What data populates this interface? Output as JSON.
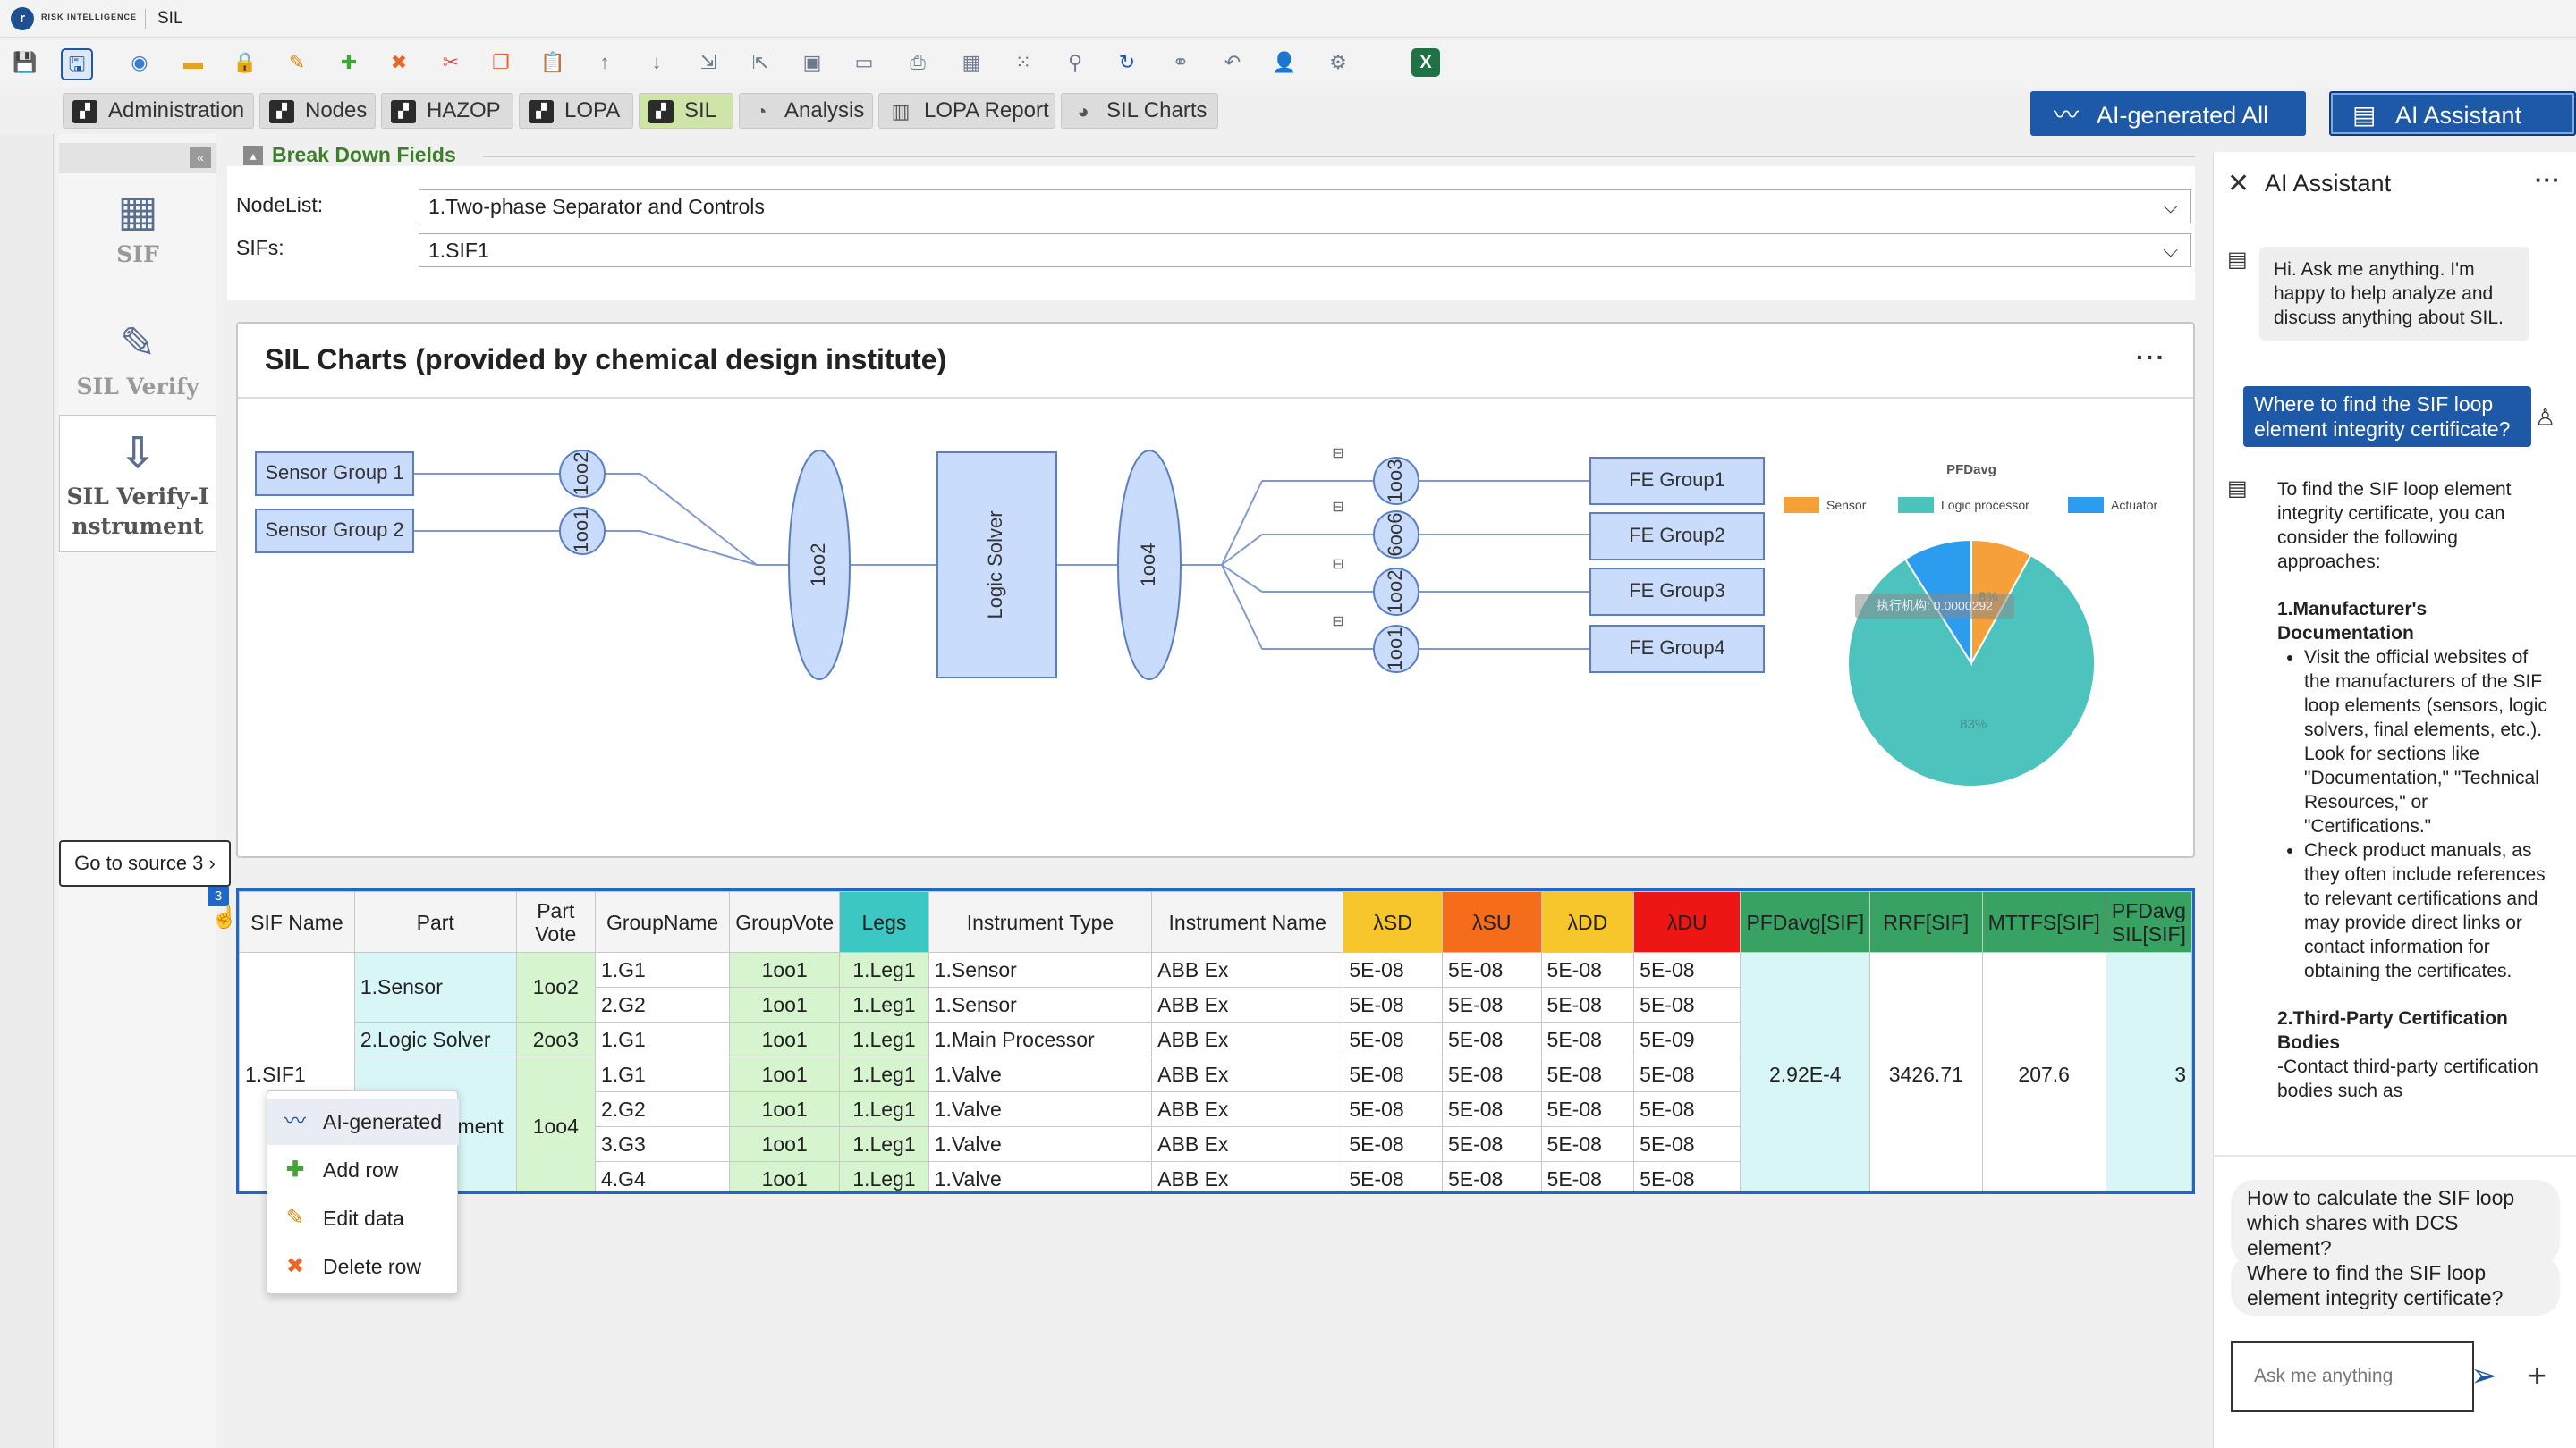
{
  "titlebar": {
    "logo_letter": "r",
    "logo_text": "RISK INTELLIGENCE",
    "title": "SIL"
  },
  "toolbar": {
    "icons": [
      "save-icon",
      "save-as-icon",
      "refresh-icon",
      "folder-icon",
      "lock-icon",
      "edit-icon",
      "add-icon",
      "delete-icon",
      "cut-icon",
      "copy-icon",
      "paste-icon",
      "arrow-up-icon",
      "arrow-down-icon",
      "import-icon",
      "export-icon",
      "layout-icon",
      "grid-icon",
      "print-icon",
      "calculate-icon",
      "color-icon",
      "filter-icon",
      "sync-icon",
      "link-icon",
      "undo-icon",
      "user-icon",
      "settings-icon",
      "excel-icon"
    ]
  },
  "left_gutter": {
    "expand_label": "»"
  },
  "tabs": [
    {
      "label": "Administration",
      "icon": "module-icon",
      "active": false
    },
    {
      "label": "Nodes",
      "icon": "module-icon",
      "active": false
    },
    {
      "label": "HAZOP",
      "icon": "module-icon",
      "active": false
    },
    {
      "label": "LOPA",
      "icon": "module-icon",
      "active": false
    },
    {
      "label": "SIL",
      "icon": "module-icon",
      "active": true
    },
    {
      "label": "Analysis",
      "icon": "analysis-icon",
      "active": false
    },
    {
      "label": "LOPA Report",
      "icon": "report-icon",
      "active": false
    },
    {
      "label": "SIL Charts",
      "icon": "pie-chart-icon",
      "active": false
    }
  ],
  "top_buttons": {
    "ai_generated_all": "AI-generated All",
    "ai_assistant": "AI Assistant"
  },
  "sidebar": {
    "collapse_label": "«",
    "items": [
      {
        "label": "SIF",
        "icon": "sif-grid-icon"
      },
      {
        "label": "SIL Verify",
        "icon": "verify-edit-icon"
      },
      {
        "label_line1": "SIL Verify-I",
        "label_line2": "nstrument",
        "icon": "instrument-verify-icon"
      }
    ]
  },
  "breakdown": {
    "title": "Break Down Fields",
    "toggle": "▴",
    "nodelist_label": "NodeList:",
    "nodelist_value": "1.Two-phase Separator and Controls",
    "sifs_label": "SIFs:",
    "sifs_value": "1.SIF1",
    "chevron": "⌵"
  },
  "chart_card": {
    "title": "SIL Charts (provided by chemical design institute)",
    "more": "···",
    "diagram": {
      "sensor_groups": [
        "Sensor Group 1",
        "Sensor Group 2"
      ],
      "sensor_votes": [
        "1oo2",
        "1oo1"
      ],
      "sensor_overall_vote": "1oo2",
      "logic_solver": "Logic Solver",
      "fe_overall_vote": "1oo4",
      "fe_votes": [
        "1oo3",
        "6oo6",
        "1oo2",
        "1oo1"
      ],
      "fe_groups": [
        "FE Group1",
        "FE Group2",
        "FE Group3",
        "FE Group4"
      ],
      "collapse_marks": [
        "⊟",
        "⊟",
        "⊟",
        "⊟"
      ]
    }
  },
  "chart_data": {
    "type": "pie",
    "title": "PFDavg",
    "legend_position": "top",
    "series": [
      {
        "name": "Sensor",
        "value": 8,
        "color": "#f5a03a",
        "label": "8%"
      },
      {
        "name": "Logic processor",
        "value": 83,
        "color": "#4cc3bd",
        "label": "83%"
      },
      {
        "name": "Actuator",
        "value": 9,
        "color": "#2c9cef",
        "label": ""
      }
    ],
    "tooltip": "执行机构: 0.0000292"
  },
  "go_to_source": {
    "label": "Go to source 3",
    "chevron": "›"
  },
  "table": {
    "row_badge": "3",
    "columns": [
      "SIF Name",
      "Part",
      "Part Vote",
      "GroupName",
      "GroupVote",
      "Legs",
      "Instrument Type",
      "Instrument Name",
      "λSD",
      "λSU",
      "λDD",
      "λDU",
      "PFDavg[SIF]",
      "RRF[SIF]",
      "MTTFS[SIF]",
      "PFDavg SIL[SIF]"
    ],
    "sif_name": "1.SIF1",
    "parts": [
      {
        "part": "1.Sensor",
        "vote": "1oo2",
        "rows": 2
      },
      {
        "part": "2.Logic Solver",
        "vote": "2oo3",
        "rows": 1
      },
      {
        "part": "3.Final Element",
        "vote": "1oo4",
        "rows": 4
      }
    ],
    "rows": [
      {
        "group": "1.G1",
        "gvote": "1oo1",
        "legs": "1.Leg1",
        "itype": "1.Sensor",
        "iname": "ABB Ex",
        "lsd": "5E-08",
        "lsu": "5E-08",
        "ldd": "5E-08",
        "ldu": "5E-08"
      },
      {
        "group": "2.G2",
        "gvote": "1oo1",
        "legs": "1.Leg1",
        "itype": "1.Sensor",
        "iname": "ABB Ex",
        "lsd": "5E-08",
        "lsu": "5E-08",
        "ldd": "5E-08",
        "ldu": "5E-08"
      },
      {
        "group": "1.G1",
        "gvote": "1oo1",
        "legs": "1.Leg1",
        "itype": "1.Main Processor",
        "iname": "ABB Ex",
        "lsd": "5E-08",
        "lsu": "5E-08",
        "ldd": "5E-08",
        "ldu": "5E-09"
      },
      {
        "group": "1.G1",
        "gvote": "1oo1",
        "legs": "1.Leg1",
        "itype": "1.Valve",
        "iname": "ABB Ex",
        "lsd": "5E-08",
        "lsu": "5E-08",
        "ldd": "5E-08",
        "ldu": "5E-08"
      },
      {
        "group": "2.G2",
        "gvote": "1oo1",
        "legs": "1.Leg1",
        "itype": "1.Valve",
        "iname": "ABB Ex",
        "lsd": "5E-08",
        "lsu": "5E-08",
        "ldd": "5E-08",
        "ldu": "5E-08"
      },
      {
        "group": "3.G3",
        "gvote": "1oo1",
        "legs": "1.Leg1",
        "itype": "1.Valve",
        "iname": "ABB Ex",
        "lsd": "5E-08",
        "lsu": "5E-08",
        "ldd": "5E-08",
        "ldu": "5E-08"
      },
      {
        "group": "4.G4",
        "gvote": "1oo1",
        "legs": "1.Leg1",
        "itype": "1.Valve",
        "iname": "ABB Ex",
        "lsd": "5E-08",
        "lsu": "5E-08",
        "ldd": "5E-08",
        "ldu": "5E-08"
      }
    ],
    "summary": {
      "pfdavg": "2.92E-4",
      "rrf": "3426.71",
      "mttfs": "207.6",
      "sil": "3"
    }
  },
  "context_menu": {
    "items": [
      {
        "label": "AI-generated",
        "icon": "ai-sparkline-icon"
      },
      {
        "label": "Add row",
        "icon": "add-icon"
      },
      {
        "label": "Edit data",
        "icon": "edit-icon"
      },
      {
        "label": "Delete row",
        "icon": "delete-icon"
      }
    ]
  },
  "ai_panel": {
    "title": "AI Assistant",
    "close": "✕",
    "more": "···",
    "greeting": "Hi. Ask me anything. I'm happy to help analyze and discuss anything about SIL.",
    "user_question": "Where to find the SIF loop element integrity certificate?",
    "answer": {
      "intro": "To find the SIF loop element integrity certificate, you can consider the following approaches:",
      "section1_title": "1.Manufacturer's Documentation",
      "section1_bullets": [
        "Visit the official websites of the manufacturers of the SIF loop elements (sensors, logic solvers, final elements, etc.). Look for sections like \"Documentation,\" \"Technical Resources,\" or \"Certifications.\"",
        "Check product manuals, as they often include references to relevant certifications and may provide direct links or contact information for obtaining the certificates."
      ],
      "section2_title": "2.Third-Party Certification Bodies",
      "section2_text": "-Contact third-party certification bodies such as"
    },
    "suggestions": [
      "How to calculate the SIF loop which shares with DCS element?",
      "Where to find the SIF loop element integrity certificate?"
    ],
    "input_placeholder": "Ask me anything",
    "send_icon": "➢",
    "plus_icon": "+"
  }
}
